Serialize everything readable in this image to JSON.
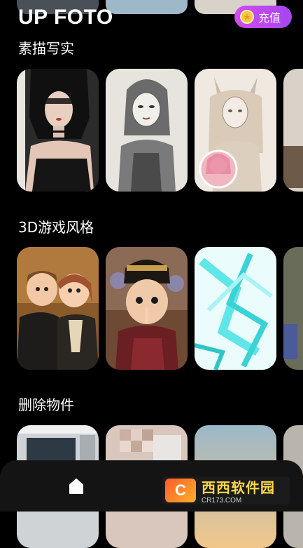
{
  "app": {
    "title": "UP FOTO"
  },
  "header": {
    "recharge_label": "充值",
    "coin_icon": "coin-icon"
  },
  "sections": [
    {
      "title": "素描写实",
      "cards": [
        "sketch-portrait-dark",
        "sketch-pencil-girl",
        "sketch-fox-girl",
        "sketch-partial"
      ]
    },
    {
      "title": "3D游戏风格",
      "cards": [
        "3d-couple",
        "3d-qing-girl",
        "3d-cyan-abstract",
        "3d-partial"
      ]
    },
    {
      "title": "删除物件",
      "cards": [
        "remove-room",
        "remove-pixelated-face",
        "remove-sunset",
        "remove-partial"
      ]
    }
  ],
  "nav": {
    "home_icon": "home-icon"
  },
  "watermark": {
    "logo_text": "C",
    "title": "西西软件园",
    "subtitle": "CR173.COM"
  },
  "colors": {
    "background": "#000000",
    "recharge_gradient": [
      "#d24cf0",
      "#a646f0"
    ],
    "nav_bg": "#141414"
  }
}
